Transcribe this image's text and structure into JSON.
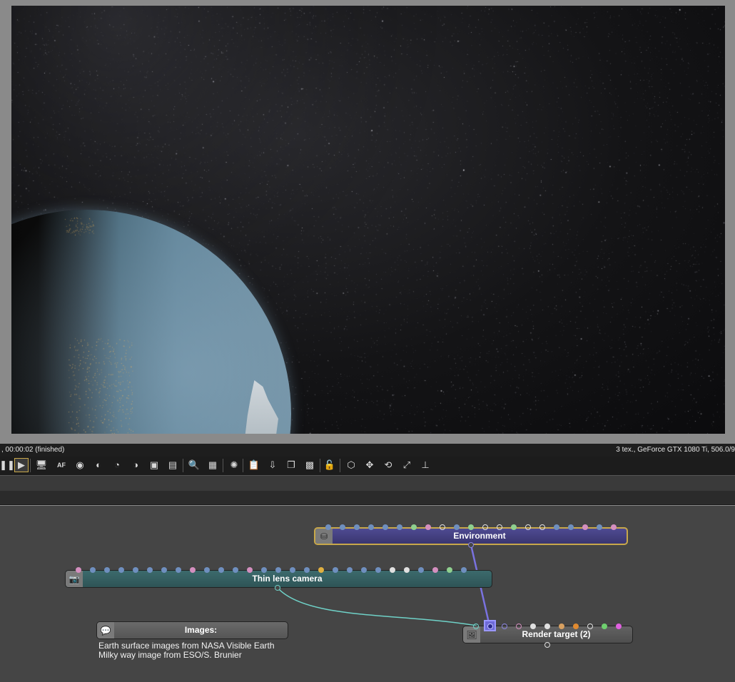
{
  "status": {
    "left": ", 00:00:02 (finished)",
    "right": "3 tex., GeForce GTX 1080 Ti, 506.0/9"
  },
  "toolbar": {
    "items": [
      {
        "name": "pause-icon",
        "glyph": "❚❚"
      },
      {
        "name": "play-icon",
        "glyph": "▶"
      },
      {
        "name": "display-icon",
        "glyph": "🖥"
      },
      {
        "name": "af-icon",
        "glyph": "AF"
      },
      {
        "name": "color-picker-icon",
        "glyph": "◉"
      },
      {
        "name": "material-picker-icon",
        "glyph": "◐"
      },
      {
        "name": "object-picker-icon",
        "glyph": "◔"
      },
      {
        "name": "camera-target-icon",
        "glyph": "◑"
      },
      {
        "name": "region-icon",
        "glyph": "▣"
      },
      {
        "name": "render-region-icon",
        "glyph": "▤"
      },
      {
        "name": "zoom-icon",
        "glyph": "🔍"
      },
      {
        "name": "pattern-icon",
        "glyph": "▦"
      },
      {
        "name": "speed-icon",
        "glyph": "✺"
      },
      {
        "name": "clipboard-icon",
        "glyph": "📋"
      },
      {
        "name": "export-icon",
        "glyph": "⇩"
      },
      {
        "name": "layers-icon",
        "glyph": "❐"
      },
      {
        "name": "checker-icon",
        "glyph": "▩"
      },
      {
        "name": "lock-icon",
        "glyph": "🔓"
      },
      {
        "name": "cube-icon",
        "glyph": "⬡"
      },
      {
        "name": "move-icon",
        "glyph": "✥"
      },
      {
        "name": "rotate-icon",
        "glyph": "⟲"
      },
      {
        "name": "fit-icon",
        "glyph": "⤢"
      },
      {
        "name": "axis-icon",
        "glyph": "⊥"
      }
    ]
  },
  "nodes": {
    "environment": {
      "title": "Environment",
      "icon": "environment-icon",
      "icon_glyph": "⛁"
    },
    "camera": {
      "title": "Thin lens camera",
      "icon": "camera-icon",
      "icon_glyph": "📷"
    },
    "images": {
      "title": "Images:",
      "icon": "comment-icon",
      "icon_glyph": "💬",
      "lines": [
        "Earth surface images from NASA Visible Earth",
        "Milky way image from ESO/S. Brunier"
      ]
    },
    "render_target": {
      "title": "Render target (2)",
      "icon": "image-icon",
      "icon_glyph": "🖼"
    }
  },
  "colors": {
    "env_pins": [
      "#6f8fbf",
      "#6f8fbf",
      "#6f8fbf",
      "#6f8fbf",
      "#6f8fbf",
      "#6f8fbf",
      "#8fd08f",
      "#d48fbf",
      "hollow",
      "#6f8fbf",
      "#8fd08f",
      "hollow",
      "hollow",
      "#8fd08f",
      "hollow",
      "hollow",
      "#6f8fbf",
      "#6f8fbf",
      "#d48fbf",
      "#6f8fbf",
      "#d48fbf"
    ],
    "cam_pins": [
      "#d48fbf",
      "#6f8fbf",
      "#6f8fbf",
      "#6f8fbf",
      "#6f8fbf",
      "#6f8fbf",
      "#6f8fbf",
      "#6f8fbf",
      "#d48fbf",
      "#6f8fbf",
      "#6f8fbf",
      "#6f8fbf",
      "#d48fbf",
      "#6f8fbf",
      "#6f8fbf",
      "#6f8fbf",
      "#6f8fbf",
      "#e0b040",
      "#6f8fbf",
      "#6f8fbf",
      "#6f8fbf",
      "#6f8fbf",
      "#e0e0e0",
      "#e0e0e0",
      "#6f8fbf",
      "#d48fbf",
      "#8fd08f",
      "#6f8fbf"
    ],
    "rt_pins": [
      "hollow-teal",
      "selected",
      "hollow-purple",
      "hollow-pink",
      "#e0e0e0",
      "#e0e0e0",
      "#d8a060",
      "#e08a30",
      "hollow",
      "#6fd06f",
      "#e060e0"
    ]
  }
}
